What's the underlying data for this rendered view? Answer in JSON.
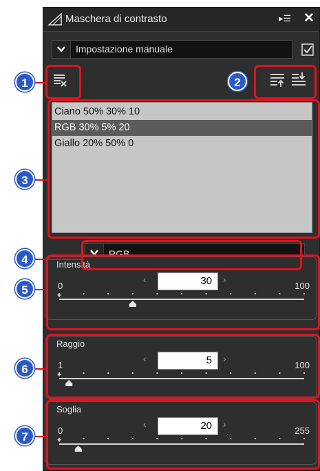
{
  "title": "Maschera di contrasto",
  "preset": "Impostazione manuale",
  "preset_enabled": true,
  "list_items": [
    "Ciano 50% 30% 10",
    "RGB 30% 5% 20",
    "Giallo 20% 50% 0"
  ],
  "selected_index": 1,
  "color_channel": "RGB",
  "intensity": {
    "label": "Intensità",
    "min": "0",
    "max": "100",
    "value": "30",
    "fraction": 0.3
  },
  "radius": {
    "label": "Raggio",
    "min": "1",
    "max": "100",
    "value": "5",
    "fraction": 0.04
  },
  "threshold": {
    "label": "Soglia",
    "min": "0",
    "max": "255",
    "value": "20",
    "fraction": 0.078
  },
  "callouts": [
    "1",
    "2",
    "3",
    "4",
    "5",
    "6",
    "7"
  ],
  "accent_color": "#e0131e",
  "callout_color": "#2c59c8"
}
